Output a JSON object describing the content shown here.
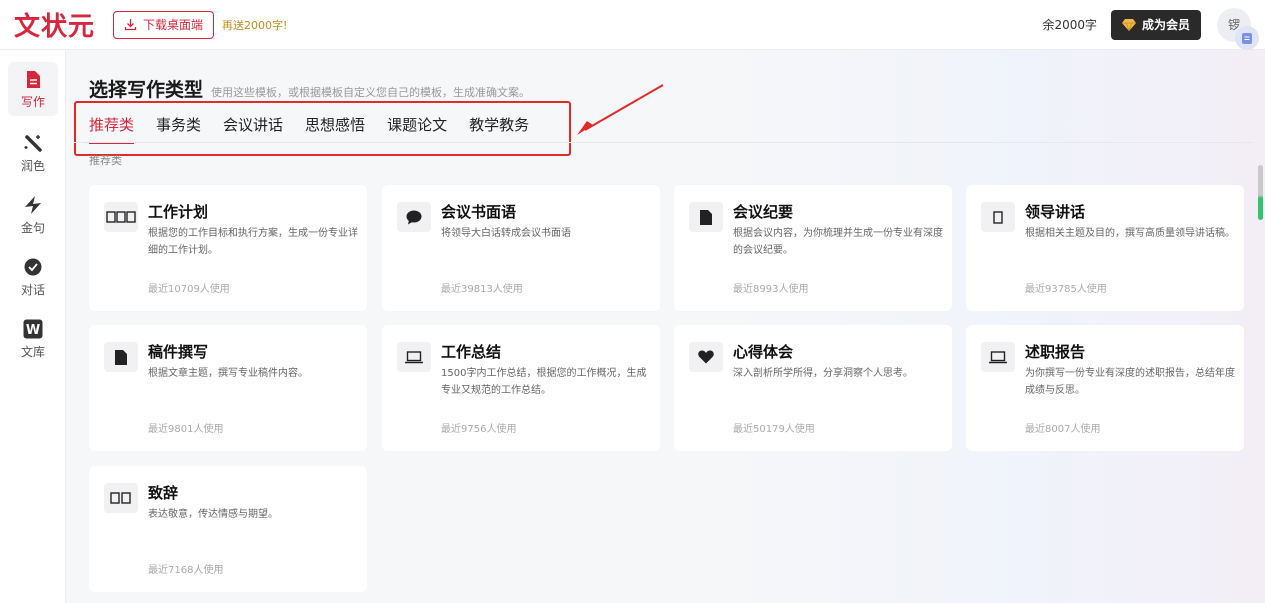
{
  "header": {
    "logo": "文状元",
    "download_label": "下载桌面端",
    "promo": "再送2000字!",
    "remaining": "余2000字",
    "vip_label": "成为会员",
    "avatar_text": "锣"
  },
  "sidebar": {
    "items": [
      {
        "label": "写作",
        "icon": "document-icon"
      },
      {
        "label": "润色",
        "icon": "magic-wand-icon"
      },
      {
        "label": "金句",
        "icon": "star-sparkle-icon"
      },
      {
        "label": "对话",
        "icon": "chat-bubble-icon"
      },
      {
        "label": "文库",
        "icon": "w-library-icon"
      }
    ]
  },
  "main": {
    "title": "选择写作类型",
    "subtitle": "使用这些模板，或根据模板自定义您自己的模板，生成准确文案。",
    "tabs": [
      "推荐类",
      "事务类",
      "会议讲话",
      "思想感悟",
      "课题论文",
      "教学教务"
    ],
    "section_label": "推荐类",
    "cards": [
      {
        "title": "工作计划",
        "desc": "根据您的工作目标和执行方案，生成一份专业详细的工作计划。",
        "usage": "最近10709人使用",
        "icon": "three-boxes-icon"
      },
      {
        "title": "会议书面语",
        "desc": "将领导大白话转成会议书面语",
        "usage": "最近39813人使用",
        "icon": "speech-bubble-icon"
      },
      {
        "title": "会议纪要",
        "desc": "根据会议内容，为你梳理并生成一份专业有深度的会议纪要。",
        "usage": "最近8993人使用",
        "icon": "file-icon"
      },
      {
        "title": "领导讲话",
        "desc": "根据相关主题及目的，撰写高质量领导讲话稿。",
        "usage": "最近93785人使用",
        "icon": "single-box-icon"
      },
      {
        "title": "稿件撰写",
        "desc": "根据文章主题，撰写专业稿件内容。",
        "usage": "最近9801人使用",
        "icon": "file-icon"
      },
      {
        "title": "工作总结",
        "desc": "1500字内工作总结，根据您的工作概况，生成专业又规范的工作总结。",
        "usage": "最近9756人使用",
        "icon": "laptop-icon"
      },
      {
        "title": "心得体会",
        "desc": "深入剖析所学所得，分享洞察个人思考。",
        "usage": "最近50179人使用",
        "icon": "heart-icon"
      },
      {
        "title": "述职报告",
        "desc": "为你撰写一份专业有深度的述职报告，总结年度成绩与反思。",
        "usage": "最近8007人使用",
        "icon": "laptop-icon"
      },
      {
        "title": "致辞",
        "desc": "表达敬意，传达情感与期望。",
        "usage": "最近7168人使用",
        "icon": "two-boxes-icon"
      }
    ]
  },
  "colors": {
    "accent": "#d7263d",
    "annotation": "#e02b2b",
    "scroll_green": "#32c36c"
  }
}
